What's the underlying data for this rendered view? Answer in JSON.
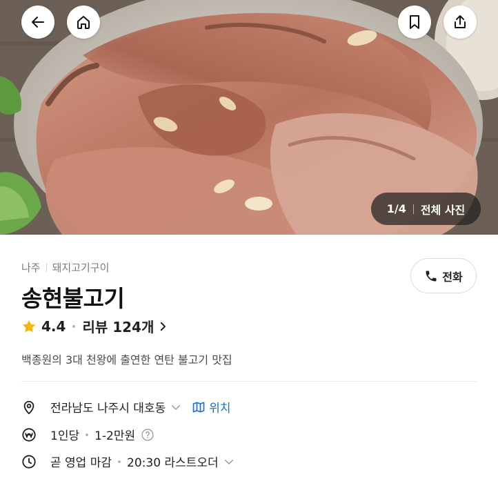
{
  "hero": {
    "photo_index": "1/4",
    "all_photos_label": "전체 사진"
  },
  "restaurant": {
    "region": "나주",
    "category": "돼지고기구이",
    "name": "송현불고기",
    "rating": "4.4",
    "reviews_label": "리뷰 124개",
    "description": "백종원의 3대 천왕에 출연한 연탄 불고기 맛집"
  },
  "actions": {
    "call_label": "전화"
  },
  "details": {
    "address": "전라남도 나주시 대호동",
    "location_label": "위치",
    "party": "1인당",
    "price_range": "1-2만원",
    "hours_status": "곧 영업 마감",
    "last_order": "20:30 라스트오더"
  },
  "colors": {
    "star": "#f5b50a",
    "link": "#1a6fd9",
    "counter_bg": "#202020"
  },
  "icons": [
    "back-arrow-icon",
    "home-icon",
    "bookmark-icon",
    "share-icon",
    "phone-icon",
    "star-icon",
    "chevron-right-icon",
    "location-pin-icon",
    "chevron-down-icon",
    "map-icon",
    "won-icon",
    "help-icon",
    "clock-icon"
  ]
}
